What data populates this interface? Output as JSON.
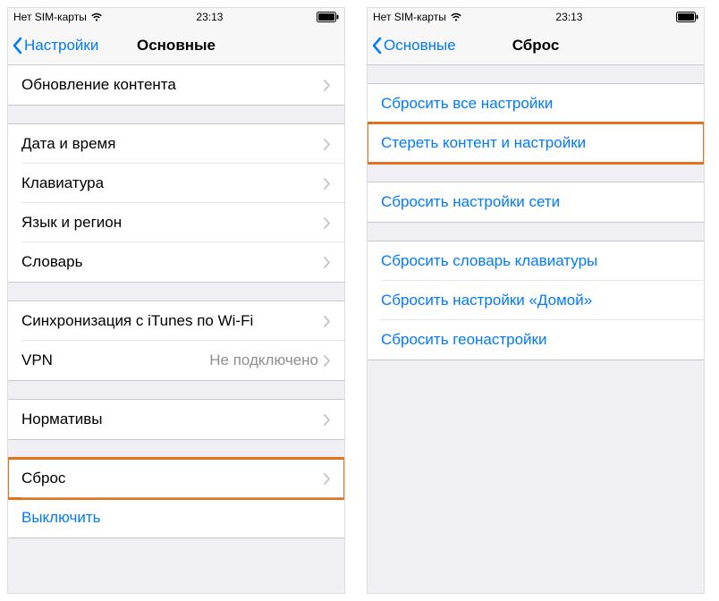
{
  "left": {
    "status": {
      "carrier": "Нет SIM-карты",
      "time": "23:13"
    },
    "nav": {
      "back": "Настройки",
      "title": "Основные"
    },
    "g1": {
      "r0": "Обновление контента"
    },
    "g2": {
      "r0": "Дата и время",
      "r1": "Клавиатура",
      "r2": "Язык и регион",
      "r3": "Словарь"
    },
    "g3": {
      "r0": "Синхронизация с iTunes по Wi-Fi",
      "r1": "VPN",
      "r1detail": "Не подключено"
    },
    "g4": {
      "r0": "Нормативы"
    },
    "g5": {
      "r0": "Сброс",
      "r1": "Выключить"
    }
  },
  "right": {
    "status": {
      "carrier": "Нет SIM-карты",
      "time": "23:13"
    },
    "nav": {
      "back": "Основные",
      "title": "Сброс"
    },
    "g1": {
      "r0": "Сбросить все настройки",
      "r1": "Стереть контент и настройки"
    },
    "g2": {
      "r0": "Сбросить настройки сети"
    },
    "g3": {
      "r0": "Сбросить словарь клавиатуры",
      "r1": "Сбросить настройки «Домой»",
      "r2": "Сбросить геонастройки"
    }
  }
}
